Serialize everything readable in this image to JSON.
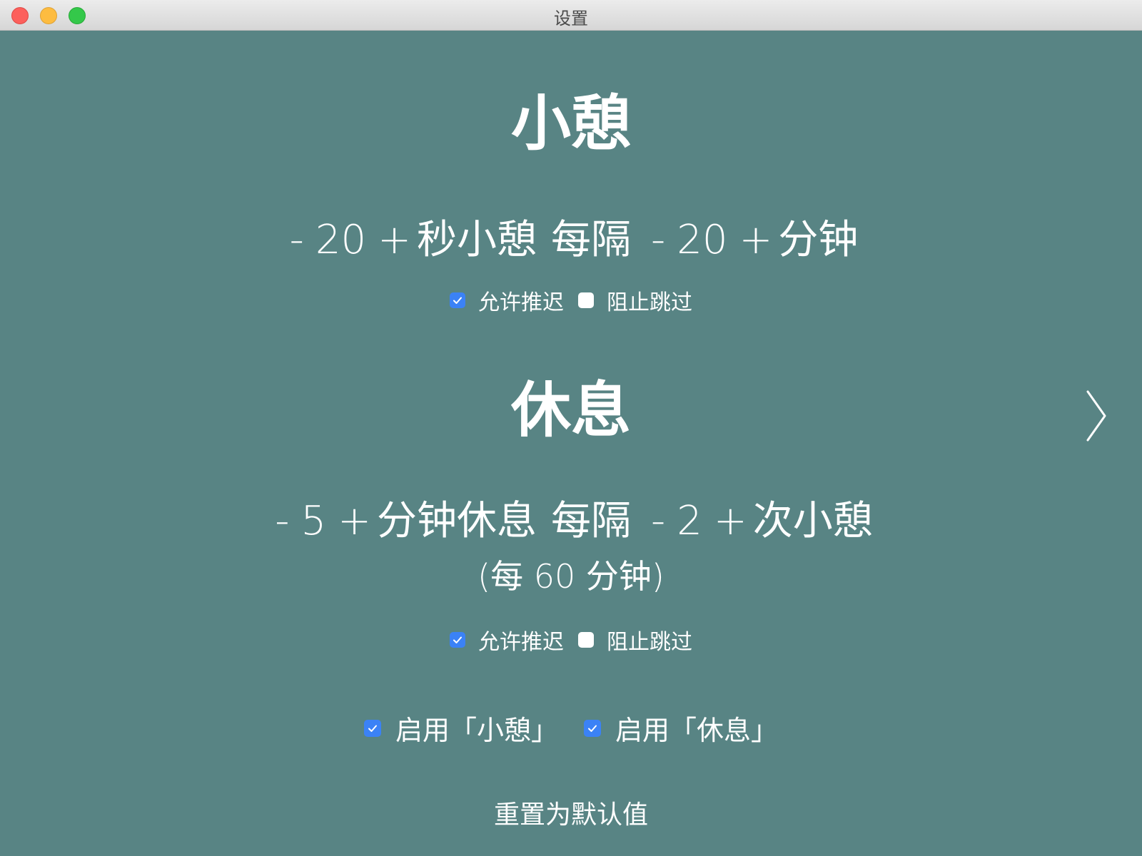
{
  "window": {
    "title": "设置"
  },
  "microbreak": {
    "heading": "小憩",
    "minus": "-",
    "plus": "+",
    "duration_value": "20",
    "duration_unit": "秒小憩",
    "every_label": "每隔",
    "interval_value": "20",
    "interval_unit": "分钟",
    "allow_postpone_label": "允许推迟",
    "allow_postpone_checked": true,
    "prevent_skip_label": "阻止跳过",
    "prevent_skip_checked": false
  },
  "break": {
    "heading": "休息",
    "minus": "-",
    "plus": "+",
    "duration_value": "5",
    "duration_unit": "分钟休息",
    "every_label": "每隔",
    "interval_value": "2",
    "interval_unit": "次小憩",
    "subnote": "(每 60 分钟)",
    "allow_postpone_label": "允许推迟",
    "allow_postpone_checked": true,
    "prevent_skip_label": "阻止跳过",
    "prevent_skip_checked": false
  },
  "enable": {
    "microbreak_label": "启用「小憩」",
    "microbreak_checked": true,
    "break_label": "启用「休息」",
    "break_checked": true
  },
  "reset_label": "重置为默认值",
  "icons": {
    "next": "chevron-right-icon",
    "check": "checkmark-icon"
  },
  "colors": {
    "background": "#588484",
    "checkbox_accent": "#3b82f6",
    "text": "#ffffff"
  }
}
